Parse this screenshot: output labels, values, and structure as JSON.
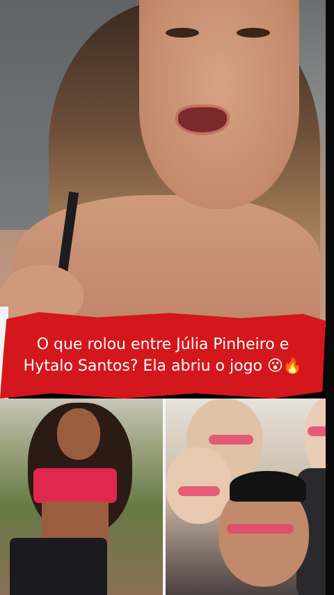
{
  "banner": {
    "headline": "O que rolou entre Júlia Pinheiro e Hytalo Santos? Ela abriu o jogo 😮🔥"
  },
  "colors": {
    "banner_red": "#d4171c",
    "banner_text": "#ffffff"
  }
}
